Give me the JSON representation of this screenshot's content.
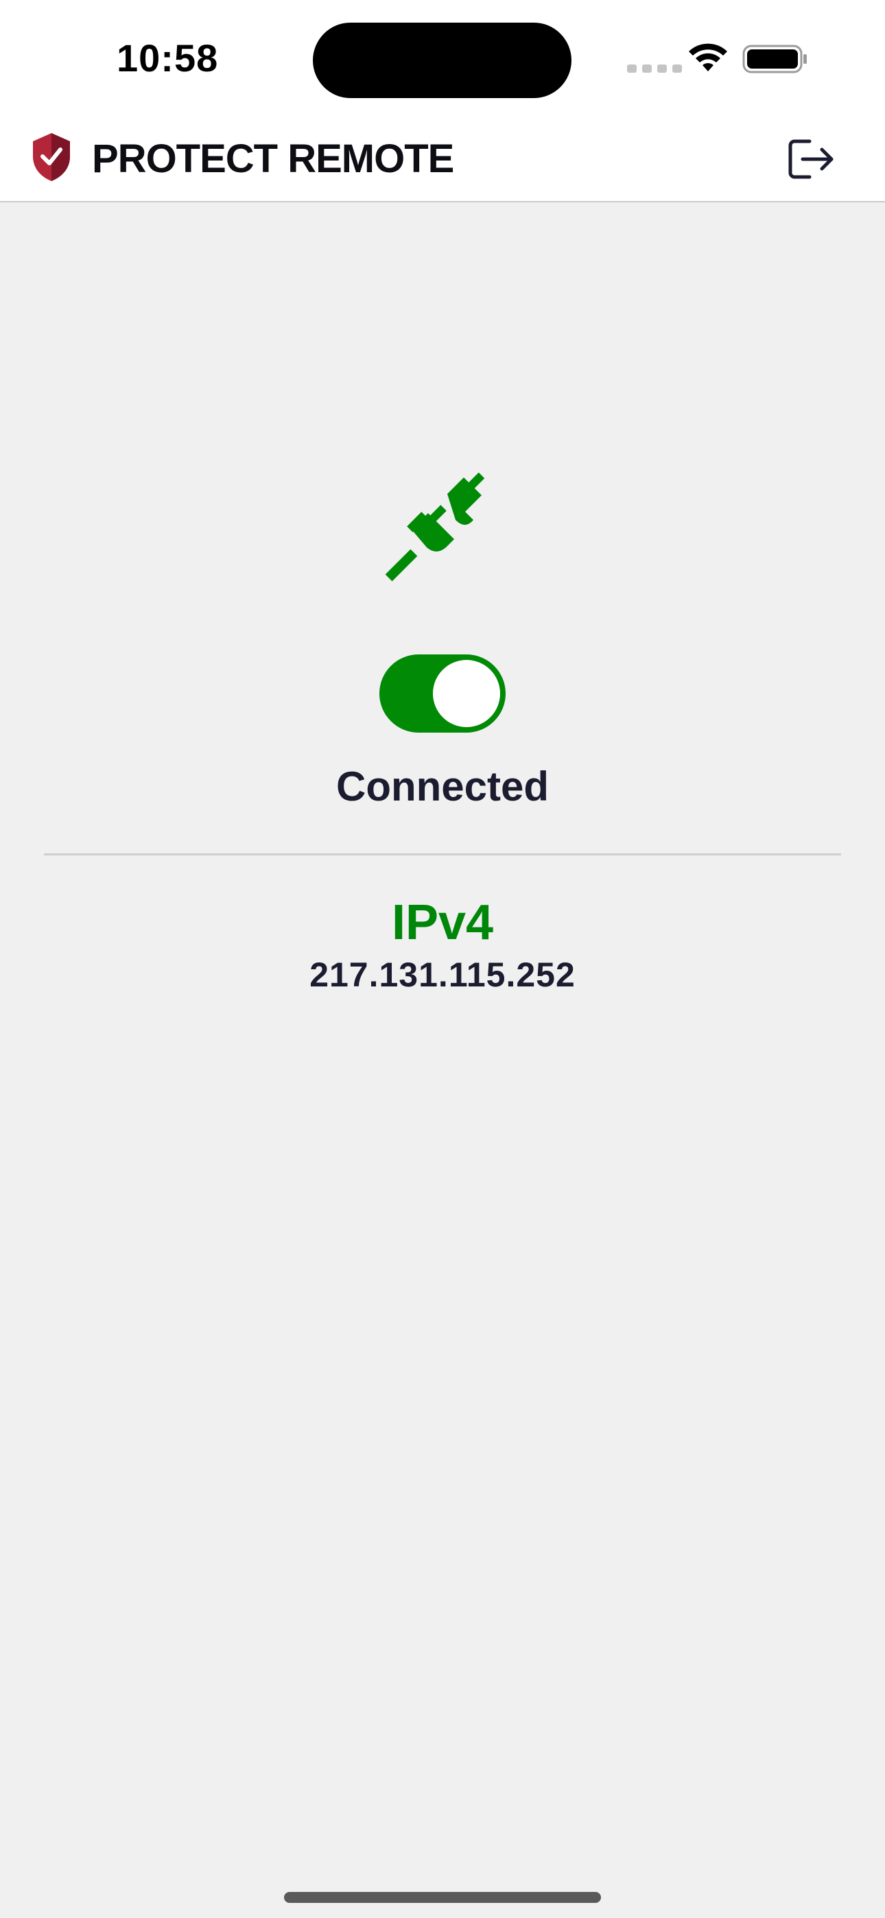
{
  "status_bar": {
    "time": "10:58",
    "icons": [
      "cellular-signal-icon",
      "wifi-icon",
      "battery-icon"
    ]
  },
  "header": {
    "logo_icon": "shield-check-icon",
    "title": "PROTECT REMOTE",
    "logout_icon": "logout-icon"
  },
  "connection": {
    "icon": "plug-connected-icon",
    "toggle_on": true,
    "status": "Connected"
  },
  "ip": {
    "version_label": "IPv4",
    "address": "217.131.115.252"
  },
  "colors": {
    "accent_green": "#008a05",
    "brand_red": "#b3263a",
    "text_dark": "#1b1c30",
    "background": "#f0f0f0"
  }
}
